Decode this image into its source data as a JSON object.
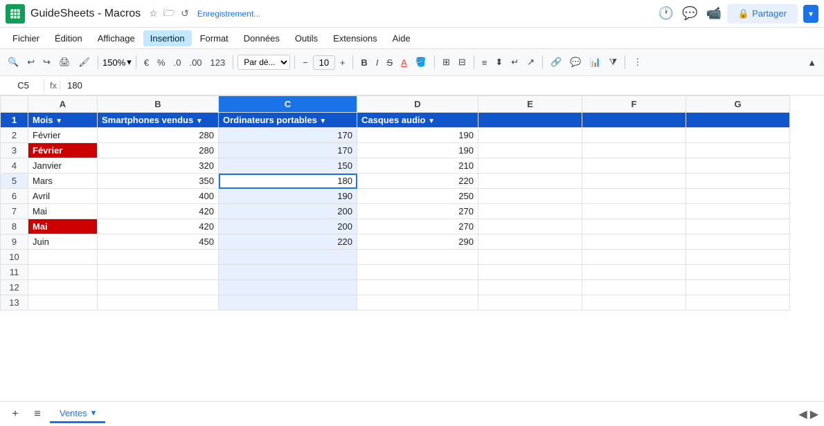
{
  "titlebar": {
    "logo": "S",
    "title": "GuideSheets - Macros",
    "save_status": "Enregistrement...",
    "share_label": "Partager"
  },
  "menubar": {
    "items": [
      "Fichier",
      "Édition",
      "Affichage",
      "Insertion",
      "Format",
      "Données",
      "Outils",
      "Extensions",
      "Aide"
    ]
  },
  "toolbar": {
    "zoom": "150%",
    "currency": "€",
    "percent": "%",
    "decimal1": ".0",
    "decimal2": ".00",
    "format_num": "123",
    "font_family": "Par dé...",
    "font_size": "10"
  },
  "formulabar": {
    "cell_ref": "C5",
    "formula": "180"
  },
  "sheet": {
    "columns": [
      "",
      "A",
      "B",
      "C",
      "D",
      "E",
      "F",
      "G"
    ],
    "rows": [
      {
        "num": 1,
        "cells": [
          "Mois",
          "Smartphones vendus",
          "Ordinateurs portables",
          "Casques audio"
        ]
      },
      {
        "num": 2,
        "cells": [
          "Février",
          "280",
          "170",
          "190"
        ]
      },
      {
        "num": 3,
        "cells": [
          "Février",
          "280",
          "170",
          "190"
        ],
        "red_a": true
      },
      {
        "num": 4,
        "cells": [
          "Janvier",
          "320",
          "150",
          "210"
        ]
      },
      {
        "num": 5,
        "cells": [
          "Mars",
          "350",
          "180",
          "220"
        ],
        "active_c": true
      },
      {
        "num": 6,
        "cells": [
          "Avril",
          "400",
          "190",
          "250"
        ]
      },
      {
        "num": 7,
        "cells": [
          "Mai",
          "420",
          "200",
          "270"
        ]
      },
      {
        "num": 8,
        "cells": [
          "Mai",
          "420",
          "200",
          "270"
        ],
        "red_a": true
      },
      {
        "num": 9,
        "cells": [
          "Juin",
          "450",
          "220",
          "290"
        ]
      },
      {
        "num": 10,
        "cells": [
          "",
          "",
          "",
          ""
        ]
      },
      {
        "num": 11,
        "cells": [
          "",
          "",
          "",
          ""
        ]
      },
      {
        "num": 12,
        "cells": [
          "",
          "",
          "",
          ""
        ]
      },
      {
        "num": 13,
        "cells": [
          "",
          "",
          "",
          ""
        ]
      }
    ]
  },
  "tabbar": {
    "sheet_name": "Ventes",
    "add_label": "+",
    "menu_label": "≡"
  }
}
